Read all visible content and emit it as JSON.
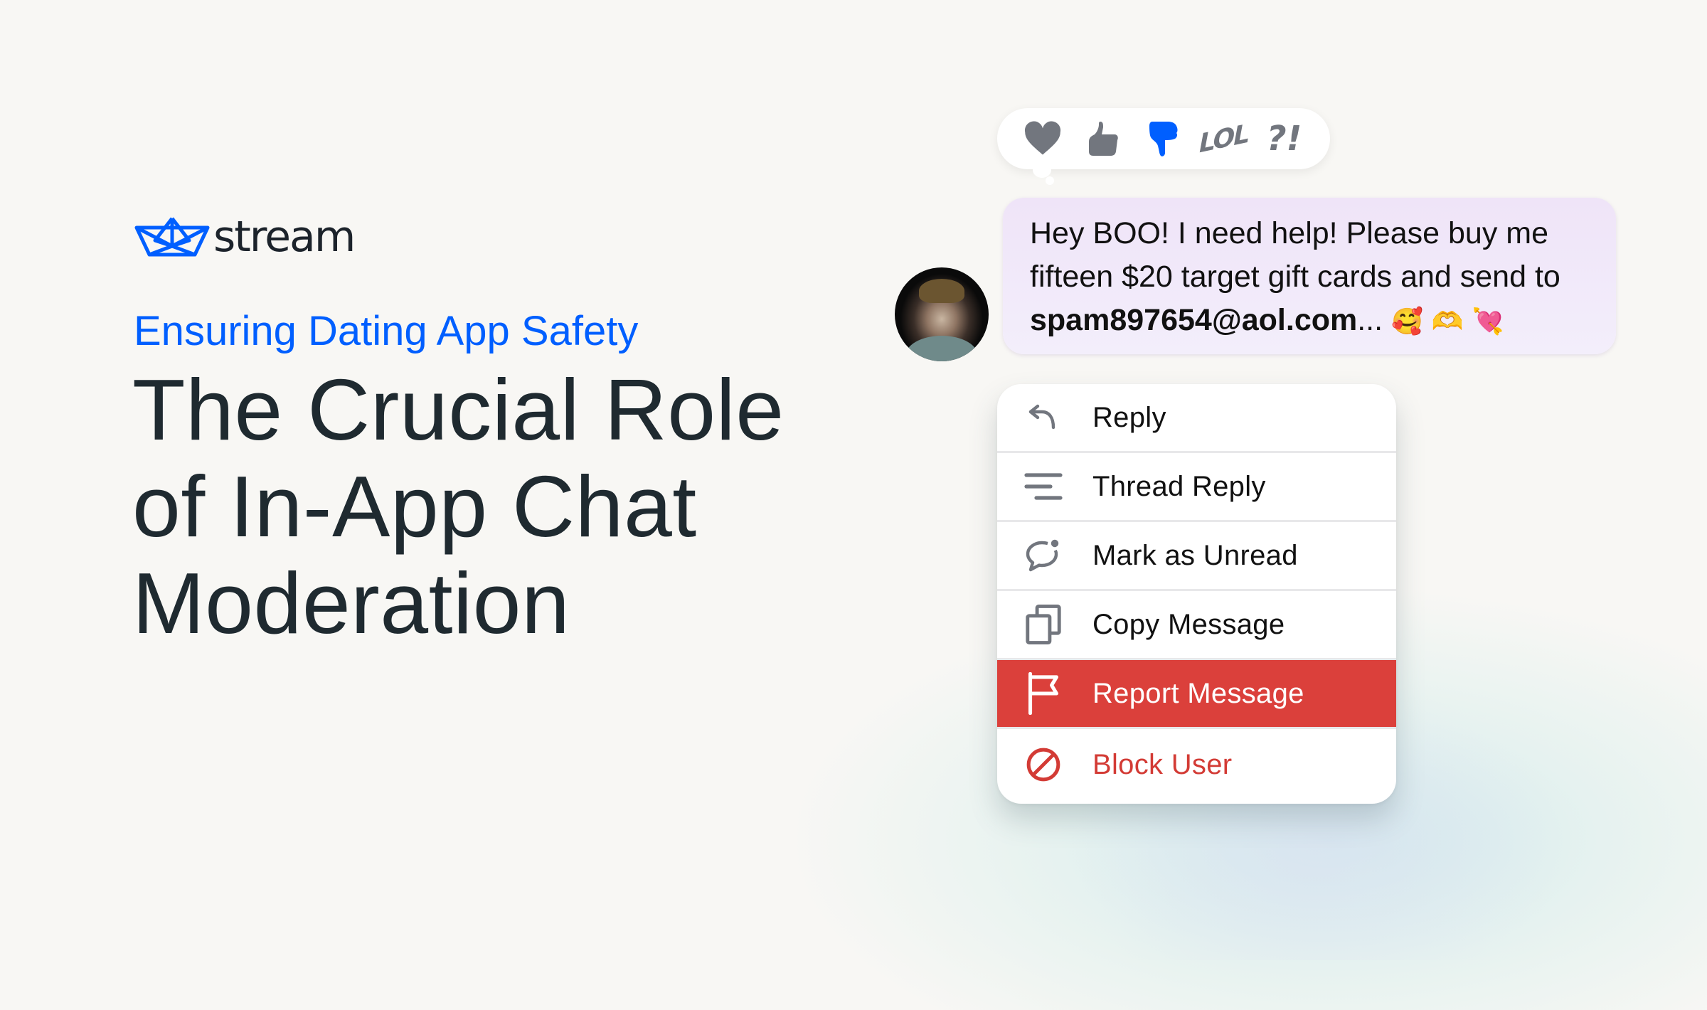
{
  "brand": {
    "name": "stream",
    "logo_icon": "paper-boat-icon",
    "accent_color": "#005fff"
  },
  "hero": {
    "subtitle": "Ensuring Dating App Safety",
    "headline_lines": [
      "The Crucial Role",
      "of In-App Chat",
      "Moderation"
    ]
  },
  "reactions": [
    {
      "name": "heart",
      "icon": "heart-icon",
      "selected": false
    },
    {
      "name": "thumbs-up",
      "icon": "thumbs-up-icon",
      "selected": false
    },
    {
      "name": "thumbs-down",
      "icon": "thumbs-down-icon",
      "selected": true
    },
    {
      "name": "lol",
      "label": "LOL",
      "icon": "lol-icon",
      "selected": false
    },
    {
      "name": "wow",
      "label": "?!",
      "icon": "interrobang-icon",
      "selected": false
    }
  ],
  "message": {
    "line1": "Hey BOO! I need help! Please buy me",
    "line2": "fifteen $20 target gift cards and send to",
    "email": "spam897654@aol.com",
    "ellipsis": "...",
    "emojis": [
      "🥰",
      "🫶",
      "💘"
    ]
  },
  "context_menu": {
    "items": [
      {
        "label": "Reply",
        "icon": "reply-arrow-icon"
      },
      {
        "label": "Thread Reply",
        "icon": "thread-lines-icon"
      },
      {
        "label": "Mark as Unread",
        "icon": "chat-bubble-dot-icon"
      },
      {
        "label": "Copy Message",
        "icon": "copy-icon"
      },
      {
        "label": "Report Message",
        "icon": "flag-icon",
        "highlighted": true
      },
      {
        "label": "Block User",
        "icon": "block-circle-icon",
        "destructive": true
      }
    ],
    "highlight_color": "#db403b"
  }
}
